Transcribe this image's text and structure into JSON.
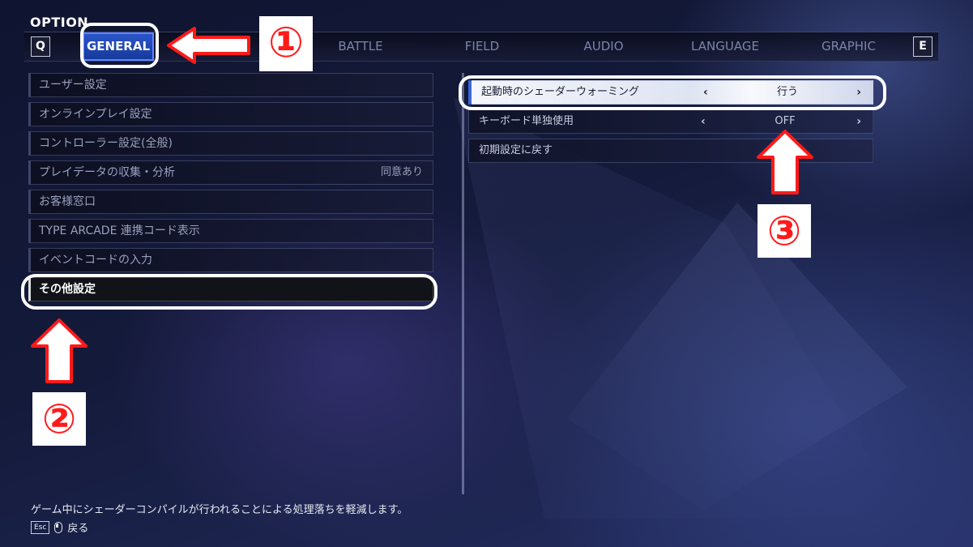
{
  "title": "OPTION",
  "keys": {
    "prev": "Q",
    "next": "E"
  },
  "tabs": [
    {
      "label": "GENERAL",
      "active": true
    },
    {
      "label": "BATTLE"
    },
    {
      "label": "FIELD"
    },
    {
      "label": "AUDIO"
    },
    {
      "label": "LANGUAGE"
    },
    {
      "label": "GRAPHIC"
    }
  ],
  "left_menu": [
    {
      "label": "ユーザー設定",
      "value": ""
    },
    {
      "label": "オンラインプレイ設定",
      "value": ""
    },
    {
      "label": "コントローラー設定(全般)",
      "value": ""
    },
    {
      "label": "プレイデータの収集・分析",
      "value": "同意あり"
    },
    {
      "label": "お客様窓口",
      "value": ""
    },
    {
      "label": "TYPE ARCADE 連携コード表示",
      "value": ""
    },
    {
      "label": "イベントコードの入力",
      "value": ""
    },
    {
      "label": "その他設定",
      "value": "",
      "active": true
    }
  ],
  "right_menu": [
    {
      "label": "起動時のシェーダーウォーミング",
      "value": "行う",
      "active": true,
      "arrows": true
    },
    {
      "label": "キーボード単独使用",
      "value": "OFF",
      "arrows": true
    },
    {
      "label": "初期設定に戻す",
      "value": "",
      "arrows": false
    }
  ],
  "annotations": {
    "n1": "①",
    "n2": "②",
    "n3": "③"
  },
  "footer": {
    "description": "ゲーム中にシェーダーコンパイルが行われることによる処理落ちを軽減します。",
    "esc_key": "Esc",
    "back_label": "戻る"
  },
  "colors": {
    "accent": "#2b55c8",
    "annotation_red": "#ff1a1a"
  }
}
